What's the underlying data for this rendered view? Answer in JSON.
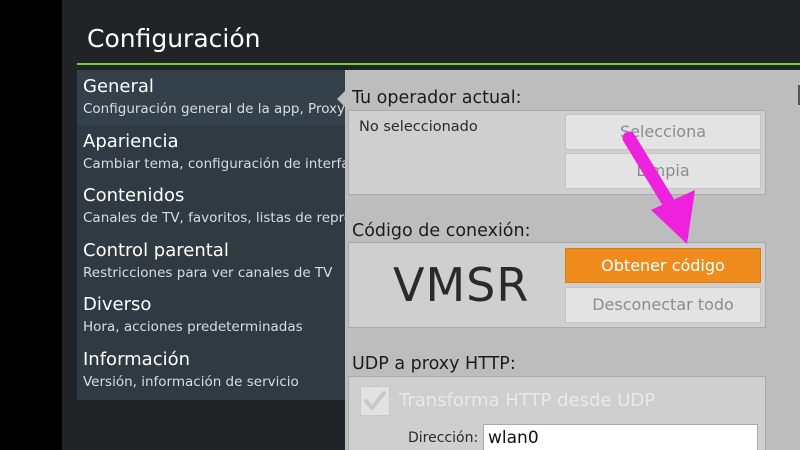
{
  "window": {
    "title": "Configuración"
  },
  "sidebar": {
    "items": [
      {
        "title": "General",
        "subtitle": "Configuración general de la app, Proxy U"
      },
      {
        "title": "Apariencia",
        "subtitle": "Cambiar tema, configuración de interfa"
      },
      {
        "title": "Contenidos",
        "subtitle": "Canales de TV, favoritos, listas de repro"
      },
      {
        "title": "Control parental",
        "subtitle": "Restricciones para ver canales de TV"
      },
      {
        "title": "Diverso",
        "subtitle": "Hora, acciones predeterminadas"
      },
      {
        "title": "Información",
        "subtitle": "Versión, información de servicio"
      }
    ]
  },
  "operator": {
    "label": "Tu operador actual:",
    "status": "No seleccionado",
    "select_button": "Selecciona",
    "clear_button": "Limpia"
  },
  "connection": {
    "label": "Código de conexión:",
    "code": "VMSR",
    "get_code_button": "Obtener código",
    "disconnect_button": "Desconectar todo"
  },
  "udp": {
    "label": "UDP a proxy HTTP:",
    "checkbox_label": "Transforma HTTP desde UDP",
    "checkbox_checked": true,
    "address_label": "Dirección:",
    "address_value": "wlan0"
  },
  "colors": {
    "accent_rule": "#6fd23a",
    "primary_button": "#f08b1d",
    "annotation_arrow": "#ee22dd"
  }
}
